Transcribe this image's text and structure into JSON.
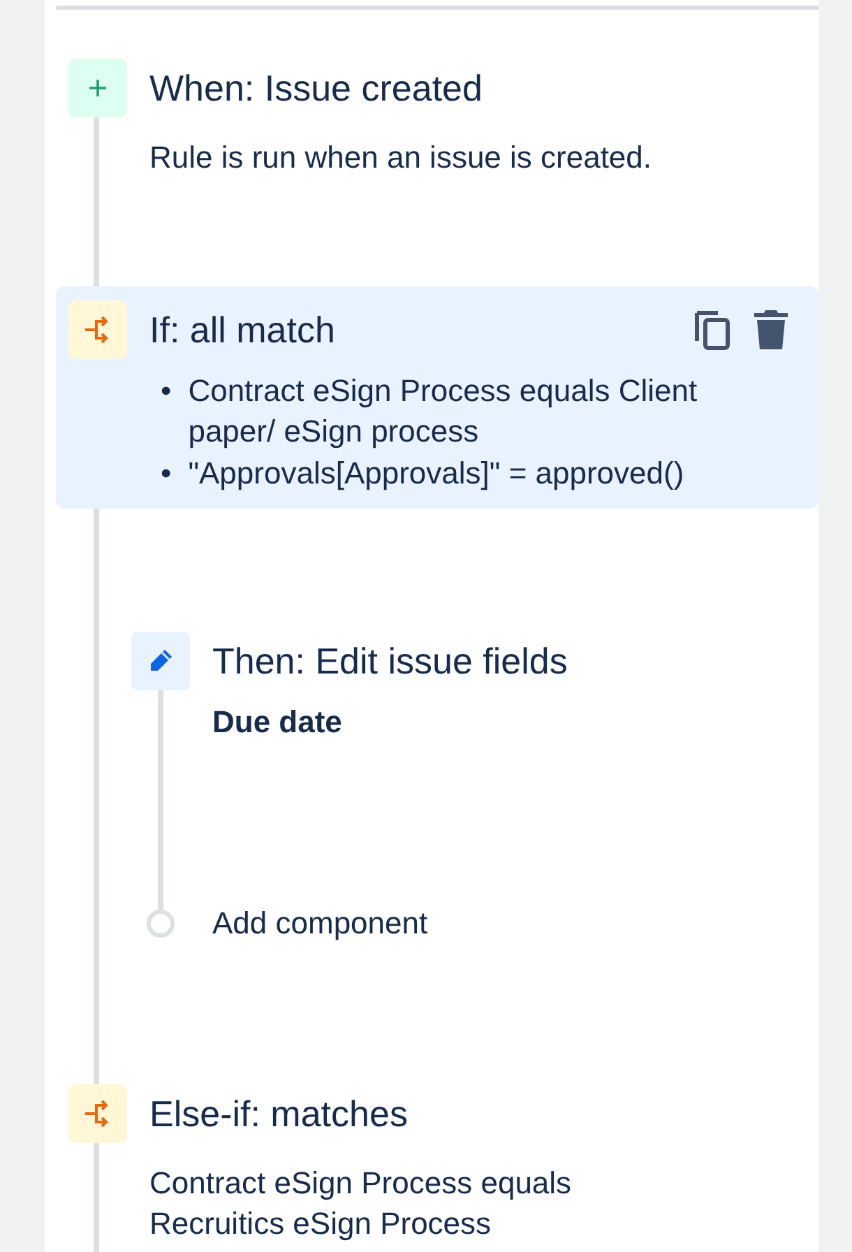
{
  "rule_components": [
    {
      "kind": "trigger",
      "title": "When: Issue created",
      "description": "Rule is run when an issue is created.",
      "selected": false
    },
    {
      "kind": "condition",
      "title": "If: all match",
      "selected": true,
      "conditions": [
        {
          "bullet": "•",
          "text": "Contract eSign Process equals Client paper/ eSign process"
        },
        {
          "bullet": "•",
          "text": "\"Approvals[Approvals]\" = approved()"
        }
      ],
      "children": [
        {
          "kind": "action",
          "title": "Then: Edit issue fields",
          "fields": [
            "Due date"
          ],
          "selected": false
        },
        {
          "kind": "add",
          "label": "Add component"
        }
      ]
    },
    {
      "kind": "condition",
      "title": "Else-if: matches",
      "description": "Contract eSign Process equals Recruitics eSign Process",
      "selected": false
    }
  ]
}
